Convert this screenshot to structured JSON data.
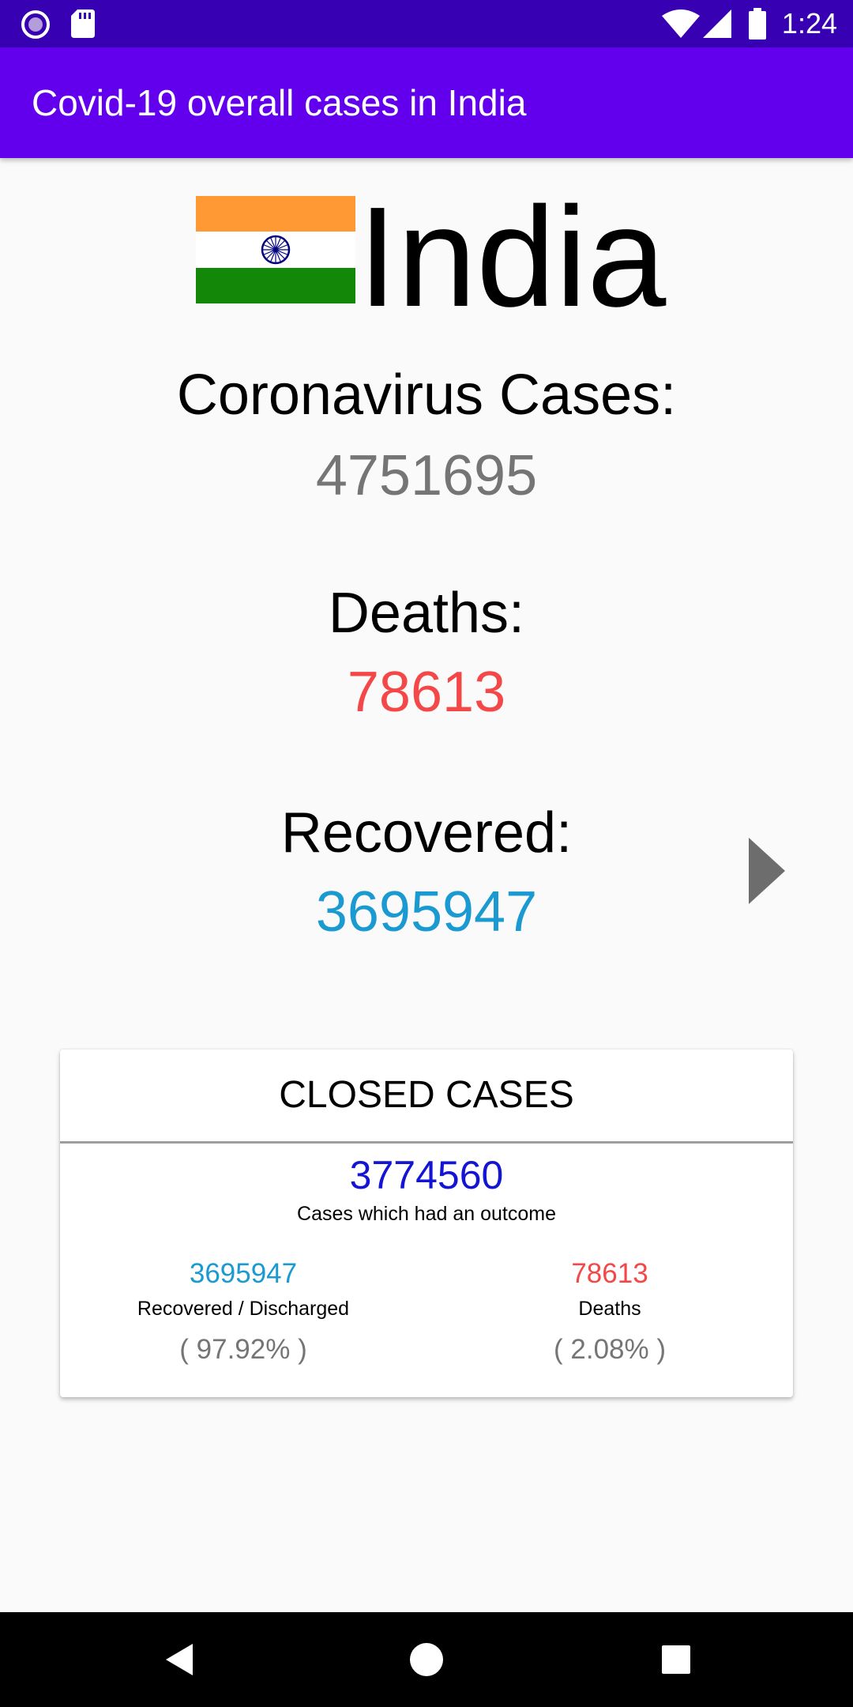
{
  "status_bar": {
    "time": "1:24",
    "icons": [
      "notification-circle-icon",
      "sd-card-icon",
      "wifi-icon",
      "cell-signal-icon",
      "battery-icon"
    ]
  },
  "app_bar": {
    "title": "Covid-19 overall cases in India"
  },
  "country": {
    "name": "India",
    "flag_icon": "india-flag-icon"
  },
  "stats": {
    "cases_label": "Coronavirus Cases:",
    "cases_value": "4751695",
    "deaths_label": "Deaths:",
    "deaths_value": "78613",
    "recovered_label": "Recovered:",
    "recovered_value": "3695947"
  },
  "closed_cases": {
    "title": "CLOSED CASES",
    "total": "3774560",
    "total_caption": "Cases which had an outcome",
    "recovered_value": "3695947",
    "recovered_caption": "Recovered / Discharged",
    "recovered_percent": "( 97.92% )",
    "deaths_value": "78613",
    "deaths_caption": "Deaths",
    "deaths_percent": "( 2.08% )"
  },
  "colors": {
    "status_bar": "#3700b3",
    "app_bar": "#6200ee",
    "cases": "#757575",
    "deaths": "#f44848",
    "recovered": "#1a9ad0",
    "closed_total": "#1414d4"
  },
  "nav_bar": {
    "icons": [
      "back-icon",
      "home-icon",
      "recents-icon"
    ]
  }
}
